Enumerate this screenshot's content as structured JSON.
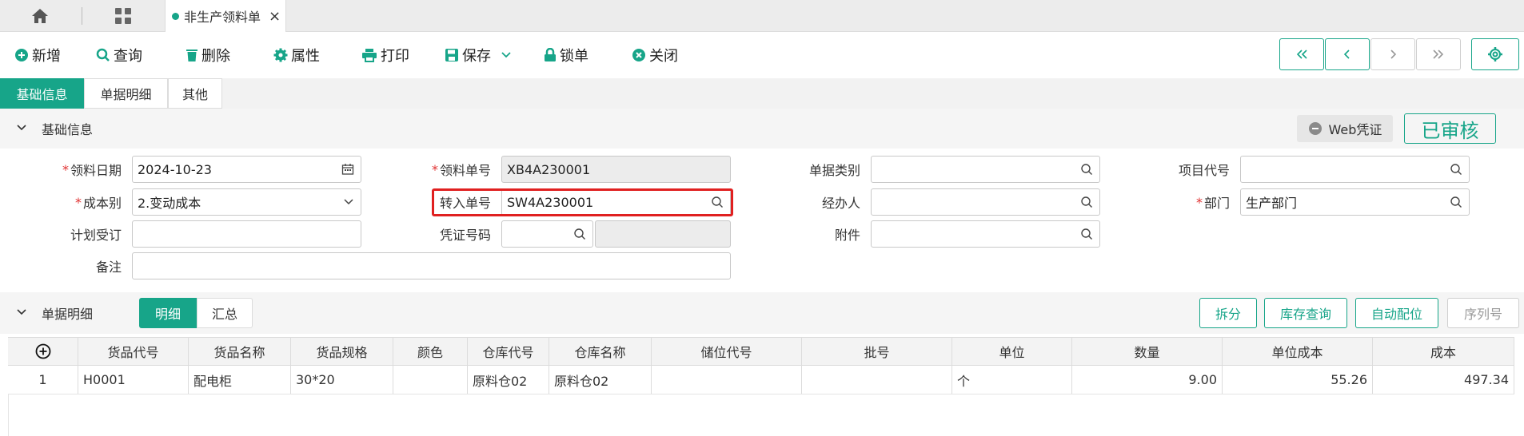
{
  "tabbar": {
    "doc_tab_label": "非生产领料单"
  },
  "toolbar": {
    "add": "新增",
    "query": "查询",
    "delete": "删除",
    "props": "属性",
    "print": "打印",
    "save": "保存",
    "lock": "锁单",
    "close": "关闭"
  },
  "section_tabs": [
    "基础信息",
    "单据明细",
    "其他"
  ],
  "basic": {
    "title": "基础信息",
    "web_voucher": "Web凭证",
    "status": "已审核",
    "fields": {
      "date_label": "领料日期",
      "date_value": "2024-10-23",
      "no_label": "领料单号",
      "no_value": "XB4A230001",
      "type_label": "单据类别",
      "type_value": "",
      "project_label": "项目代号",
      "project_value": "",
      "cost_label": "成本别",
      "cost_value": "2.变动成本",
      "transfer_label": "转入单号",
      "transfer_value": "SW4A230001",
      "handler_label": "经办人",
      "handler_value": "",
      "dept_label": "部门",
      "dept_value": "生产部门",
      "plan_label": "计划受订",
      "plan_value": "",
      "voucher_label": "凭证号码",
      "voucher_value": "",
      "attach_label": "附件",
      "attach_value": "",
      "remark_label": "备注",
      "remark_value": ""
    }
  },
  "detail": {
    "title": "单据明细",
    "tab_detail": "明细",
    "tab_summary": "汇总",
    "actions": {
      "split": "拆分",
      "stock": "库存查询",
      "auto": "自动配位",
      "serial": "序列号"
    },
    "columns": [
      "货品代号",
      "货品名称",
      "货品规格",
      "颜色",
      "仓库代号",
      "仓库名称",
      "储位代号",
      "批号",
      "单位",
      "数量",
      "单位成本",
      "成本"
    ],
    "rows": [
      {
        "idx": "1",
        "code": "H0001",
        "name": "配电柜",
        "spec": "30*20",
        "color": "",
        "wh_code": "原料仓02",
        "wh_name": "原料仓02",
        "loc": "",
        "batch": "",
        "unit": "个",
        "qty": "9.00",
        "unit_cost": "55.26",
        "cost": "497.34"
      }
    ]
  },
  "colors": {
    "accent": "#17a589",
    "highlight": "#e02020"
  }
}
